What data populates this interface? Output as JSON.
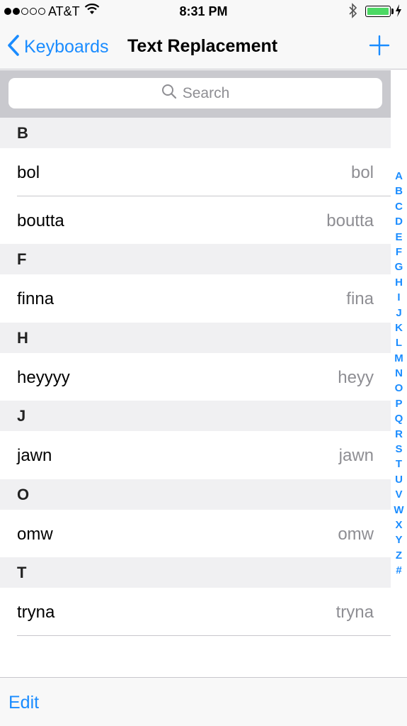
{
  "status_bar": {
    "carrier": "AT&T",
    "time": "8:31 PM",
    "signal_bars": 2,
    "battery_color": "#4cd964"
  },
  "nav": {
    "back_label": "Keyboards",
    "title": "Text Replacement",
    "add_icon": "plus-icon",
    "accent_color": "#1a8cff"
  },
  "search": {
    "placeholder": "Search"
  },
  "sections": [
    {
      "letter": "B",
      "rows": [
        {
          "phrase": "bol",
          "shortcut": "bol"
        },
        {
          "phrase": "boutta",
          "shortcut": "boutta"
        }
      ]
    },
    {
      "letter": "F",
      "rows": [
        {
          "phrase": "finna",
          "shortcut": "fina"
        }
      ]
    },
    {
      "letter": "H",
      "rows": [
        {
          "phrase": "heyyyy",
          "shortcut": "heyy"
        }
      ]
    },
    {
      "letter": "J",
      "rows": [
        {
          "phrase": "jawn",
          "shortcut": "jawn"
        }
      ]
    },
    {
      "letter": "O",
      "rows": [
        {
          "phrase": "omw",
          "shortcut": "omw"
        }
      ]
    },
    {
      "letter": "T",
      "rows": [
        {
          "phrase": "tryna",
          "shortcut": "tryna"
        }
      ]
    }
  ],
  "index_letters": [
    "A",
    "B",
    "C",
    "D",
    "E",
    "F",
    "G",
    "H",
    "I",
    "J",
    "K",
    "L",
    "M",
    "N",
    "O",
    "P",
    "Q",
    "R",
    "S",
    "T",
    "U",
    "V",
    "W",
    "X",
    "Y",
    "Z",
    "#"
  ],
  "toolbar": {
    "edit_label": "Edit"
  }
}
